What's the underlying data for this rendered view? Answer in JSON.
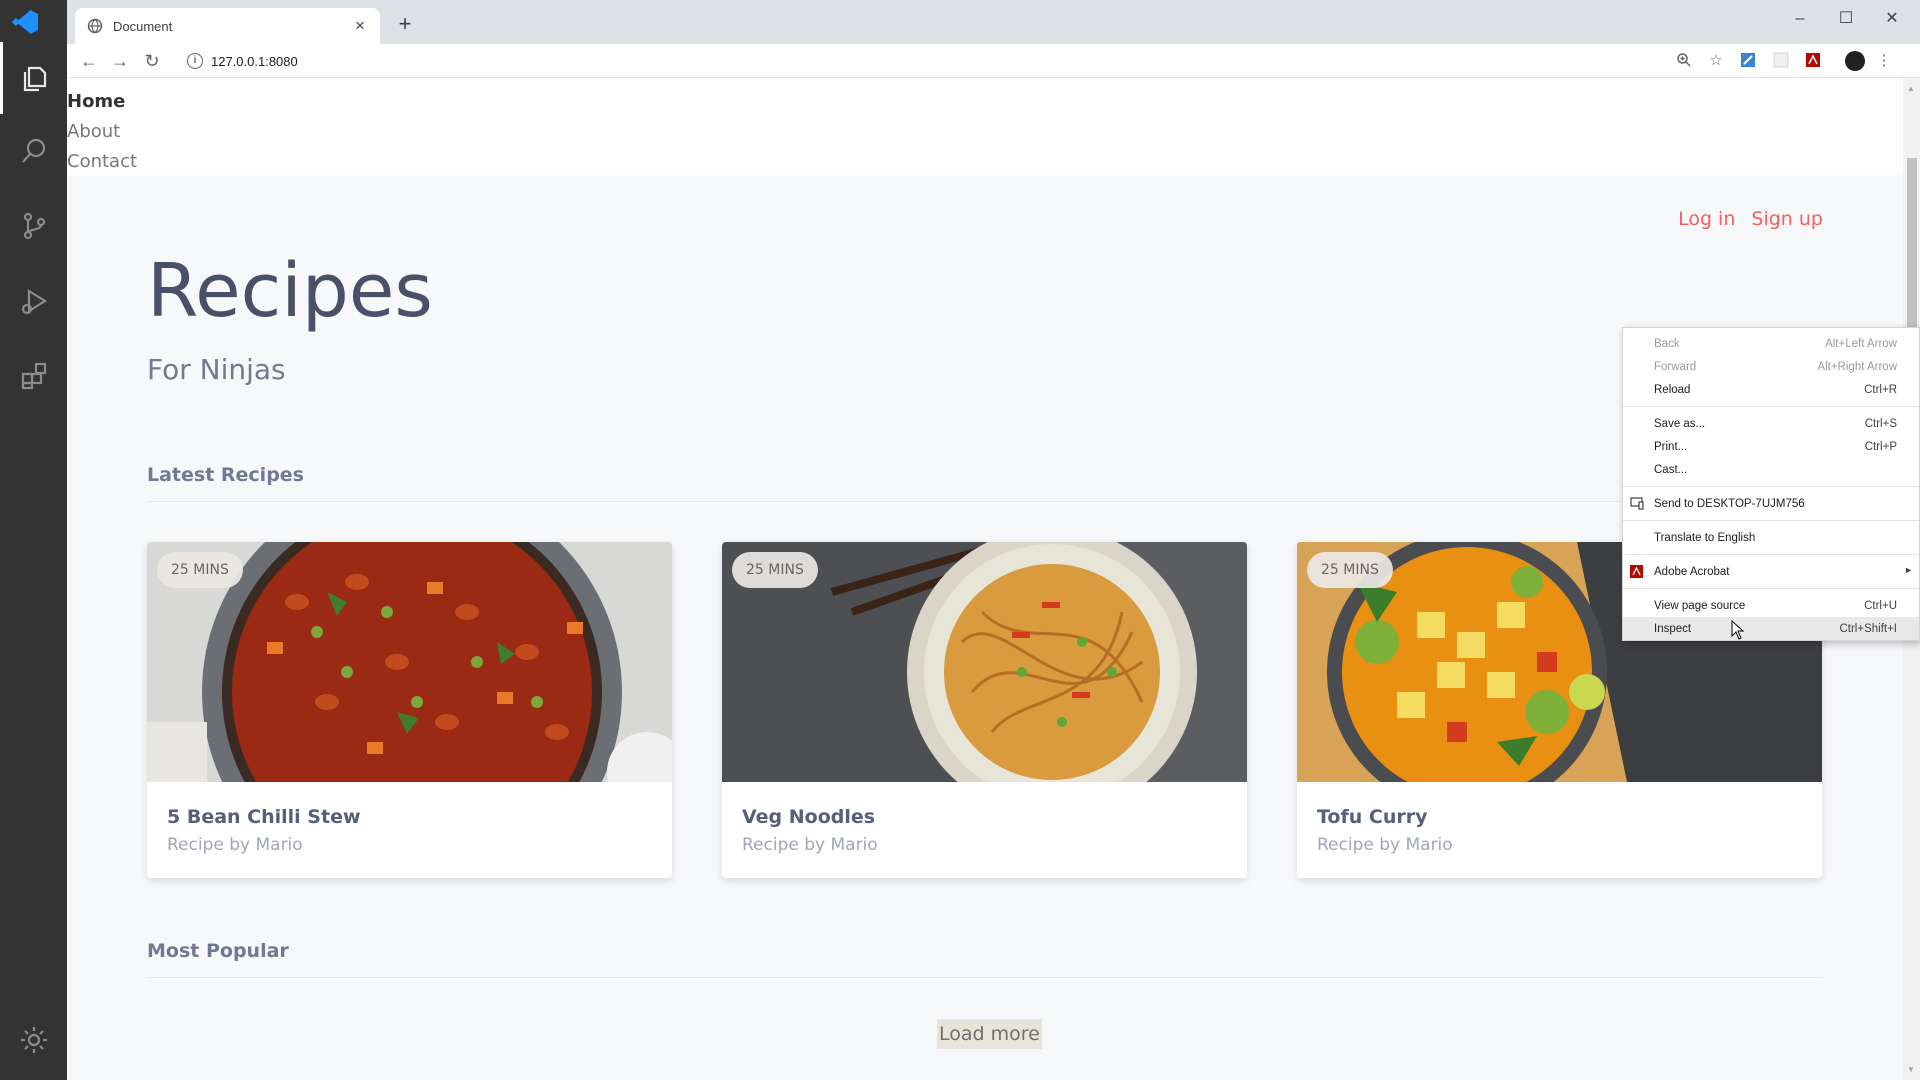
{
  "browser": {
    "tab_title": "Document",
    "tab_close": "×",
    "new_tab": "+",
    "url": "127.0.0.1:8080",
    "window_controls": {
      "minimize": "–",
      "maximize": "☐",
      "close": "✕"
    }
  },
  "site": {
    "nav": [
      "Home",
      "About",
      "Contact"
    ],
    "auth": {
      "login": "Log in",
      "signup": "Sign up"
    },
    "title": "Recipes",
    "subtitle": "For Ninjas",
    "latest_heading": "Latest Recipes",
    "popular_heading": "Most Popular",
    "load_more": "Load more",
    "cards": [
      {
        "badge": "25 MINS",
        "title": "5 Bean Chilli Stew",
        "byline": "Recipe by Mario"
      },
      {
        "badge": "25 MINS",
        "title": "Veg Noodles",
        "byline": "Recipe by Mario"
      },
      {
        "badge": "25 MINS",
        "title": "Tofu Curry",
        "byline": "Recipe by Mario"
      }
    ]
  },
  "context_menu": {
    "items": [
      {
        "label": "Back",
        "shortcut": "Alt+Left Arrow",
        "disabled": true
      },
      {
        "label": "Forward",
        "shortcut": "Alt+Right Arrow",
        "disabled": true
      },
      {
        "label": "Reload",
        "shortcut": "Ctrl+R"
      },
      {
        "label": "Save as...",
        "shortcut": "Ctrl+S"
      },
      {
        "label": "Print...",
        "shortcut": "Ctrl+P"
      },
      {
        "label": "Cast...",
        "shortcut": ""
      },
      {
        "label": "Send to DESKTOP-7UJM756",
        "shortcut": ""
      },
      {
        "label": "Translate to English",
        "shortcut": ""
      },
      {
        "label": "Adobe Acrobat",
        "shortcut": ""
      },
      {
        "label": "View page source",
        "shortcut": "Ctrl+U"
      },
      {
        "label": "Inspect",
        "shortcut": "Ctrl+Shift+I"
      }
    ]
  },
  "colors": {
    "activity_bar": "#333333",
    "accent_link": "#f06060",
    "vscode_blue": "#1e90ff"
  }
}
